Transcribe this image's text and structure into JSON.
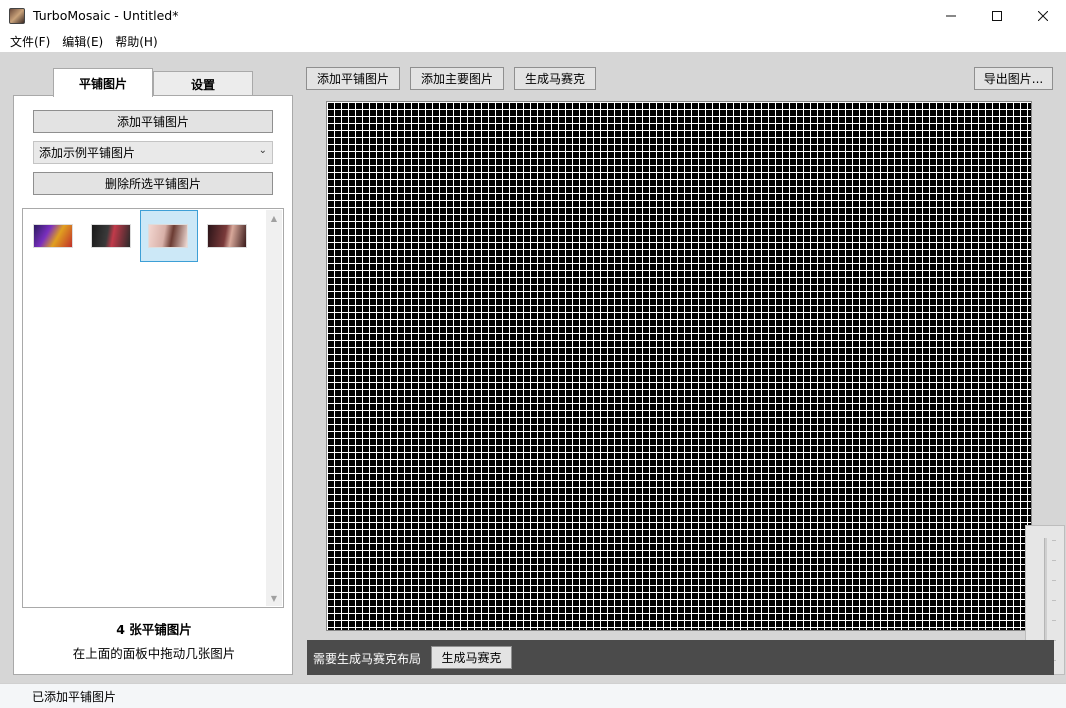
{
  "window": {
    "title": "TurboMosaic - Untitled*"
  },
  "menu": [
    "文件(F)",
    "编辑(E)",
    "帮助(H)"
  ],
  "tabs": {
    "tiles": "平铺图片",
    "settings": "设置"
  },
  "left": {
    "add_tiles_button": "添加平铺图片",
    "sample_dropdown": "添加示例平铺图片",
    "remove_button": "删除所选平铺图片",
    "tile_count": "4 张平铺图片",
    "drag_hint": "在上面的面板中拖动几张图片"
  },
  "toolbar": {
    "add_tiles": "添加平铺图片",
    "add_main": "添加主要图片",
    "generate": "生成马赛克",
    "export": "导出图片..."
  },
  "gen_bar": {
    "message": "需要生成马赛克布局",
    "button": "生成马赛克"
  },
  "status": "已添加平铺图片",
  "icons": {
    "app": "app-icon",
    "minimize": "minimize-icon",
    "maximize": "maximize-icon",
    "close": "close-icon",
    "dropdown": "chevron-down-icon"
  }
}
